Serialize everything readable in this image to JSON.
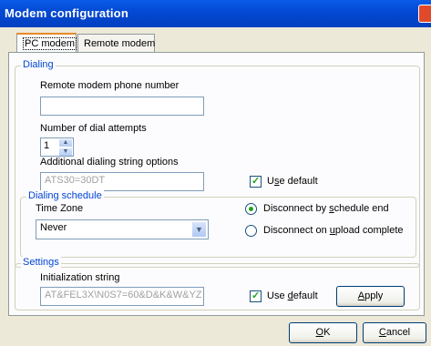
{
  "window": {
    "title": "Modem configuration"
  },
  "tabs": [
    "PC modem",
    "Remote modem"
  ],
  "dialing": {
    "legend": "Dialing",
    "phone_label": "Remote modem phone number",
    "phone_value": "",
    "attempts_label": "Number of dial attempts",
    "attempts_value": "1",
    "options_label": "Additional dialing string options",
    "options_value": "ATS30=30DT",
    "use_default_pre": "U",
    "use_default_ul": "s",
    "use_default_post": "e default",
    "use_default_checked": true
  },
  "schedule": {
    "legend": "Dialing schedule",
    "timezone_label": "Time Zone",
    "timezone_value": "Never",
    "radio1_pre": "Disconnect by ",
    "radio1_ul": "s",
    "radio1_post": "chedule end",
    "radio1_selected": true,
    "radio2_pre": "Disconnect on ",
    "radio2_ul": "u",
    "radio2_post": "pload complete",
    "radio2_selected": false
  },
  "settings": {
    "legend": "Settings",
    "init_label": "Initialization string",
    "init_value": "AT&FEL3X\\N0S7=60&D&K&W&YZ",
    "use_default_pre": "Use ",
    "use_default_ul": "d",
    "use_default_post": "efault",
    "use_default_checked": true,
    "apply_ul": "A",
    "apply_post": "pply"
  },
  "footer": {
    "ok_ul": "O",
    "ok_post": "K",
    "cancel_ul": "C",
    "cancel_post": "ancel"
  },
  "icons": {
    "close": "close-icon",
    "spin": "spinner-arrows-icon",
    "dropdown": "chevron-down-icon"
  },
  "colors": {
    "titlebar": "#0348d2",
    "legend": "#0046d5",
    "check": "#21a121"
  }
}
